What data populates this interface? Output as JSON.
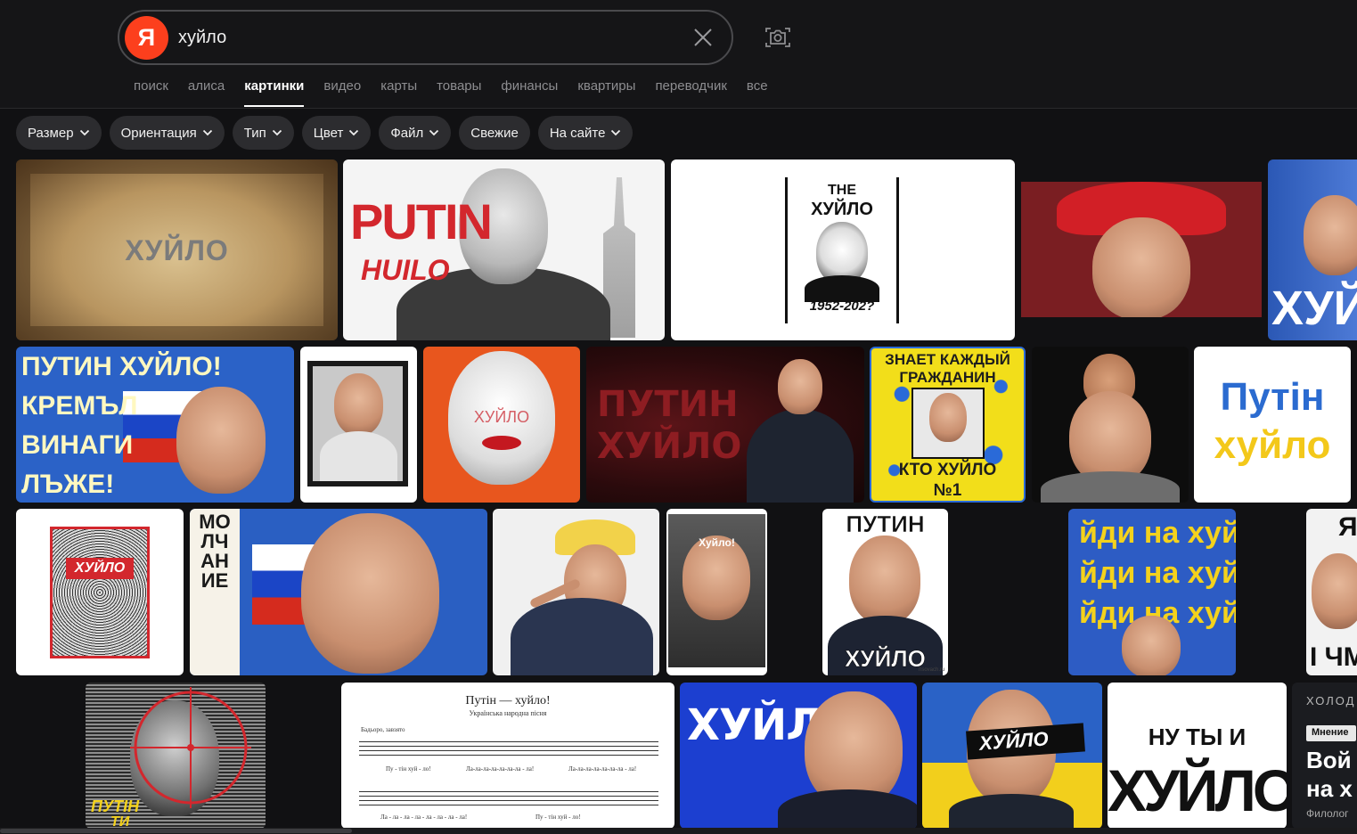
{
  "search": {
    "logo_letter": "Я",
    "query": "хуйло"
  },
  "nav": [
    "поиск",
    "алиса",
    "картинки",
    "видео",
    "карты",
    "товары",
    "финансы",
    "квартиры",
    "переводчик",
    "все"
  ],
  "nav_active": "картинки",
  "filters": [
    "Размер",
    "Ориентация",
    "Тип",
    "Цвет",
    "Файл",
    "Свежие",
    "На сайте"
  ],
  "icons": {
    "clear": "close-icon",
    "camera": "camera-search-icon",
    "dropdown": "chevron-down-icon"
  },
  "colors": {
    "accent_logo": "#fc3f1d",
    "background": "#111113",
    "chip": "#2c2c2f"
  },
  "results": {
    "r1": {
      "vintage": "ХУЙЛО",
      "putin": "PUTIN",
      "huilo": "HUILO",
      "poster_the": "THE",
      "poster_word": "ХУЙЛО",
      "poster_years": "1952-202?",
      "red_caption": "ХУЙ"
    },
    "r2": {
      "bg_line1": "ПУТИН ХУЙЛО!",
      "bg_line2": "КРЕМЪЛ",
      "bg_line3": "ВИНАГИ",
      "bg_line4": "ЛЪЖЕ!",
      "cartoon_word": "ХУЙЛО",
      "video_line1": "ПУТИН",
      "video_line2": "ХУЙЛО",
      "poster_top1": "ЗНАЕТ КАЖДЫЙ",
      "poster_top2": "ГРАЖДАНИН",
      "poster_bottom1": "КТО ХУЙЛО",
      "poster_bottom2": "№1",
      "ua_line1": "Путін",
      "ua_line2": "хуйло"
    },
    "r3": {
      "sticker_word": "ХУЙЛО",
      "vertical_word": "МОЛЧАНИЕ",
      "meme_word": "Хуйло!",
      "portrait_top": "ПУТИН",
      "portrait_bottom": "ХУЙЛО",
      "portrait_site": "risovach.ru",
      "repeat_line1": "йди на хуй",
      "repeat_line2": "йди на хуй",
      "repeat_line3": "йди на хуй",
      "edge_top": "Я",
      "edge_bottom": "І ЧМ"
    },
    "r4": {
      "target_line1": "ПУТІН",
      "target_line2": "ТИ",
      "sheet_title": "Путін — хуйло!",
      "sheet_subtitle": "Українська народна пісня",
      "sheet_tempo": "Бадьоро, завзято",
      "sheet_lyrics1a": "Пу - тін хуй - ло!",
      "sheet_lyrics1b": "Ла-ла-ла-ла-ла-ла-ла - ла!",
      "sheet_lyrics1c": "Ла-ла-ла-ла-ла-ла-ла - ла!",
      "sheet_lyrics2a": "Ла - ла - ла - ла - ла - ла - ла - ла!",
      "sheet_lyrics2b": "Пу - тін хуй - ло!",
      "blue_word": "ХУЙЛО",
      "bar_word": "ХУЙЛО",
      "big_line1": "НУ ТЫ И",
      "big_line2": "ХУЙЛО",
      "news_header": "ХОЛОД",
      "news_badge": "Мнение",
      "news_line1": "Вой",
      "news_line2": "на х",
      "news_small": "Филолог"
    }
  }
}
